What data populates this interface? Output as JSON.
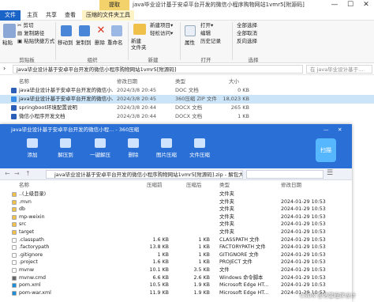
{
  "window": {
    "extract_tab": "提取",
    "title": "java毕业设计基于安卓平台开发的微信小程序购物网站1vmr5[附源码]",
    "minimize": "—",
    "maximize": "☐",
    "close": "✕"
  },
  "tabs": [
    "文件",
    "主页",
    "共享",
    "查看",
    "压缩的文件夹工具"
  ],
  "ribbon": {
    "clipboard": {
      "paste": "粘贴",
      "cut": "剪切",
      "copy_path": "复制路径",
      "paste_shortcut": "粘贴快捷方式",
      "label": "剪贴板"
    },
    "organize": {
      "move_to": "移动到",
      "copy_to": "复制到",
      "delete": "删除",
      "rename": "重命名",
      "label": "组织"
    },
    "new": {
      "new_folder": "新建\n文件夹",
      "new_item": "新建项目▾",
      "easy_access": "轻松访问▾",
      "label": "新建"
    },
    "open": {
      "properties": "属性",
      "open": "打开▾",
      "edit": "编辑",
      "history": "历史记录",
      "label": "打开"
    },
    "select": {
      "select_all": "全部选择",
      "select_none": "全部取消",
      "invert": "反向选择",
      "label": "选择"
    }
  },
  "address": {
    "path": "java毕业设计基于安卓平台开发的微信小程序购物网站1vmr5[附源码]",
    "search_placeholder": "在 java毕业设计基于..."
  },
  "explorer_columns": [
    "名称",
    "修改日期",
    "类型",
    "大小"
  ],
  "explorer_files": [
    {
      "name": "java毕业设计基于安卓平台开发的微信小...",
      "date": "2024/3/8 20:45",
      "type": "DOC 文档",
      "size": "0 KB",
      "color": "#2b5fb8",
      "selected": false
    },
    {
      "name": "java毕业设计基于安卓平台开发的微信小...",
      "date": "2024/3/8 20:45",
      "type": "360压缩 ZIP 文件",
      "size": "18,023 KB",
      "color": "#3a8ee6",
      "selected": true
    },
    {
      "name": "springboot环境配置说明",
      "date": "2024/3/8 20:44",
      "type": "DOCX 文档",
      "size": "265 KB",
      "color": "#2b5fb8",
      "selected": false
    },
    {
      "name": "微信小程序开发文档",
      "date": "2024/3/8 20:44",
      "type": "DOCX 文档",
      "size": "1 KB",
      "color": "#2b5fb8",
      "selected": false
    }
  ],
  "z360": {
    "title": "java毕业设计基于安卓平台开发的微信小程... - 360压缩",
    "toolbar": [
      "添加",
      "解压到",
      "一键解压",
      "删除",
      "图片压缩",
      "文件压缩"
    ],
    "scan": "扫描",
    "path": "java毕业设计基于安卓平台开发的微信小程序购物网站1vmr5[附源码].zip - 解包大小为...",
    "columns": [
      "名称",
      "压缩前",
      "压缩后",
      "类型",
      "修改日期"
    ],
    "rows": [
      {
        "name": "..(上级目录)",
        "before": "",
        "after": "",
        "type": "文件夹",
        "date": "",
        "color": "#f0c14a"
      },
      {
        "name": ".mvn",
        "before": "",
        "after": "",
        "type": "文件夹",
        "date": "2024-01-29 10:53",
        "color": "#f0c14a"
      },
      {
        "name": "db",
        "before": "",
        "after": "",
        "type": "文件夹",
        "date": "2024-01-29 10:53",
        "color": "#f0c14a"
      },
      {
        "name": "mp-weixin",
        "before": "",
        "after": "",
        "type": "文件夹",
        "date": "2024-01-29 10:53",
        "color": "#f0c14a"
      },
      {
        "name": "src",
        "before": "",
        "after": "",
        "type": "文件夹",
        "date": "2024-01-29 10:53",
        "color": "#f0c14a"
      },
      {
        "name": "target",
        "before": "",
        "after": "",
        "type": "文件夹",
        "date": "2024-01-29 10:53",
        "color": "#f0c14a"
      },
      {
        "name": ".classpath",
        "before": "1.6 KB",
        "after": "1 KB",
        "type": "CLASSPATH 文件",
        "date": "2024-01-29 10:53",
        "color": "#ffffff"
      },
      {
        "name": ".factorypath",
        "before": "13.8 KB",
        "after": "1 KB",
        "type": "FACTORYPATH 文件",
        "date": "2024-01-29 10:53",
        "color": "#ffffff"
      },
      {
        "name": ".gitignore",
        "before": "1 KB",
        "after": "1 KB",
        "type": "GITIGNORE 文件",
        "date": "2024-01-29 10:53",
        "color": "#ffffff"
      },
      {
        "name": ".project",
        "before": "1.6 KB",
        "after": "1 KB",
        "type": "PROJECT 文件",
        "date": "2024-01-29 10:53",
        "color": "#ffffff"
      },
      {
        "name": "mvnw",
        "before": "10.1 KB",
        "after": "3.5 KB",
        "type": "文件",
        "date": "2024-01-29 10:53",
        "color": "#ffffff"
      },
      {
        "name": "mvnw.cmd",
        "before": "6.6 KB",
        "after": "2.6 KB",
        "type": "Windows 命令脚本",
        "date": "2024-01-29 10:53",
        "color": "#666666"
      },
      {
        "name": "pom.xml",
        "before": "10.5 KB",
        "after": "1.9 KB",
        "type": "Microsoft Edge HT...",
        "date": "2024-01-29 10:53",
        "color": "#1b8fd8"
      },
      {
        "name": "pom-war.xml",
        "before": "11.9 KB",
        "after": "1.9 KB",
        "type": "Microsoft Edge HT...",
        "date": "2024-01-29 10:53",
        "color": "#1b8fd8"
      }
    ]
  },
  "watermark": "CSDN @艺馨程序设计"
}
